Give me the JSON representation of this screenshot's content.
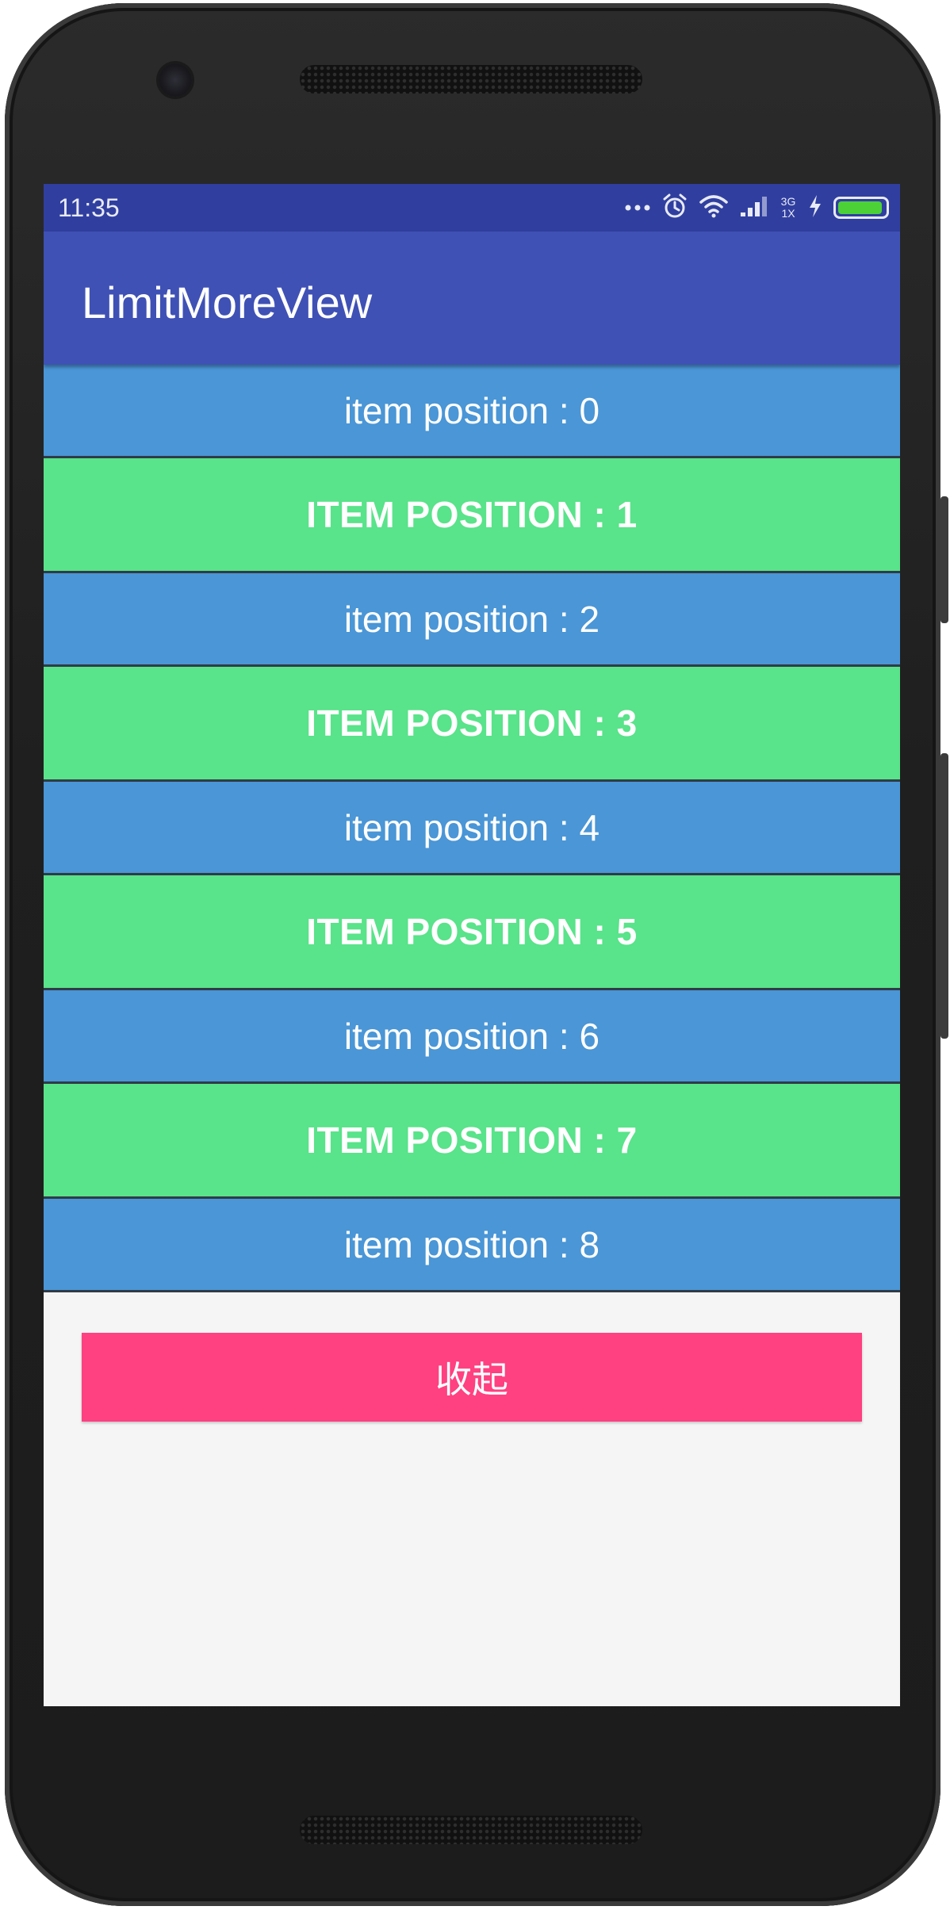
{
  "status_bar": {
    "time": "11:35",
    "network_top": "3G",
    "network_bottom": "1X",
    "battery_level": 0.95,
    "battery_color": "#4cd137",
    "icons": [
      "more-dots-icon",
      "alarm-icon",
      "wifi-icon",
      "signal-icon",
      "charging-icon",
      "battery-icon"
    ]
  },
  "toolbar": {
    "title": "LimitMoreView",
    "color": "#3f51b5",
    "status_color": "#303f9f"
  },
  "list": {
    "colors": {
      "blue": "#4a96d6",
      "green": "#59e38a"
    },
    "items": [
      {
        "label": "item position : 0",
        "style": "blue"
      },
      {
        "label": "ITEM POSITION : 1",
        "style": "green"
      },
      {
        "label": "item position : 2",
        "style": "blue"
      },
      {
        "label": "ITEM POSITION : 3",
        "style": "green"
      },
      {
        "label": "item position : 4",
        "style": "blue"
      },
      {
        "label": "ITEM POSITION : 5",
        "style": "green"
      },
      {
        "label": "item position : 6",
        "style": "blue"
      },
      {
        "label": "ITEM POSITION : 7",
        "style": "green"
      },
      {
        "label": "item position : 8",
        "style": "blue"
      }
    ]
  },
  "collapse_button": {
    "label": "收起",
    "color": "#ff4081"
  }
}
